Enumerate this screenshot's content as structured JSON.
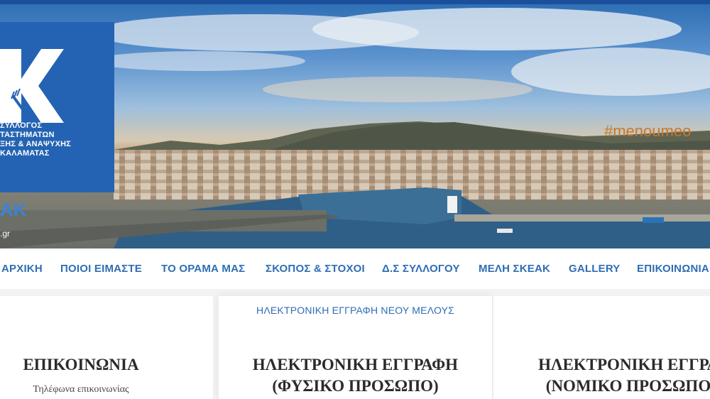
{
  "header": {
    "logo": {
      "letter": "Κ",
      "lines": [
        "ΣΥΛΛΟΓΟΣ",
        "ΤΑΣΤΗΜΑΤΩΝ",
        "ΞΗΣ & ΑΝΑΨΥΧΗΣ",
        "ΚΑΛΑΜΑΤΑΣ"
      ],
      "brand": "ΑΚ",
      "domain": ".gr"
    },
    "hashtag": "#menoumeo",
    "colors": {
      "topbar": "#1b4f9c",
      "logo_bg": "#2463b3",
      "hashtag": "#c8782a"
    }
  },
  "nav": {
    "items": [
      "ΑΡΧΙΚΗ",
      "ΠΟΙΟΙ ΕΙΜΑΣΤΕ",
      "ΤΟ ΟΡΑΜΑ ΜΑΣ",
      "ΣΚΟΠΟΣ & ΣΤΟΧΟΙ",
      "Δ.Σ ΣΥΛΛΟΓΟΥ",
      "ΜΕΛΗ ΣΚΕΑΚ",
      "GALLERY",
      "ΕΠΙΚΟΙΝΩΝΙΑ"
    ],
    "color": "#2f6db5"
  },
  "content": {
    "col1": {
      "title": "ΕΠΙΚΟΙΝΩΝΙΑ",
      "subtitle": "Τηλέφωνα επικοινωνίας"
    },
    "col2": {
      "link": "ΗΛΕΚΤΡΟΝΙΚΗ ΕΓΓΡΑΦΗ ΝΕΟΥ ΜΕΛΟΥΣ",
      "title_line1": "ΗΛΕΚΤΡΟΝΙΚΗ ΕΓΓΡΑΦΗ",
      "title_line2": "(ΦΥΣΙΚΟ ΠΡΟΣΩΠΟ)"
    },
    "col3": {
      "title_line1": "ΗΛΕΚΤΡΟΝΙΚΗ ΕΓΓΡΑ",
      "title_line2": "(ΝΟΜΙΚΟ ΠΡΟΣΩΠΟ"
    }
  }
}
